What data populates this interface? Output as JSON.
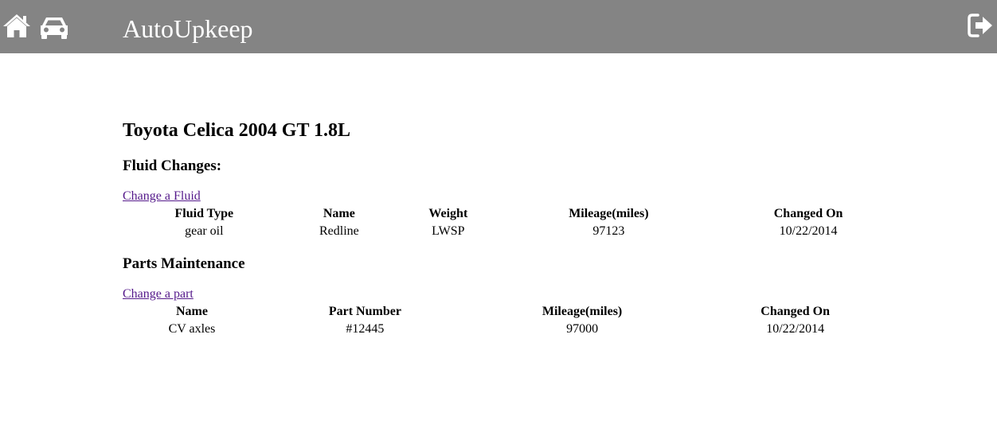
{
  "header": {
    "brand": "AutoUpkeep",
    "home_icon": "home-icon",
    "car_icon": "car-icon",
    "logout_icon": "logout-icon",
    "bar_color": "#848484"
  },
  "vehicle": {
    "title": "Toyota Celica 2004 GT 1.8L"
  },
  "fluids": {
    "heading": "Fluid Changes:",
    "link": "Change a Fluid",
    "columns": [
      "Fluid Type",
      "Name",
      "Weight",
      "Mileage(miles)",
      "Changed On"
    ],
    "rows": [
      [
        "gear oil",
        "Redline",
        "LWSP",
        "97123",
        "10/22/2014"
      ]
    ]
  },
  "parts": {
    "heading": "Parts Maintenance",
    "link": "Change a part",
    "columns": [
      "Name",
      "Part Number",
      "Mileage(miles)",
      "Changed On"
    ],
    "rows": [
      [
        "CV axles",
        "#12445",
        "97000",
        "10/22/2014"
      ]
    ]
  },
  "colors": {
    "link": "#551a8b",
    "header_text": "#ffffff"
  }
}
